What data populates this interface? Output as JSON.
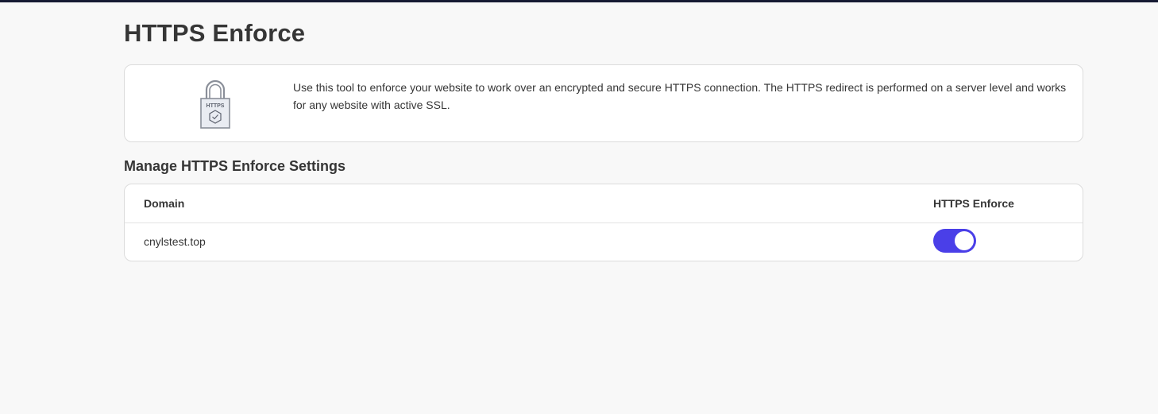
{
  "page": {
    "title": "HTTPS Enforce"
  },
  "info": {
    "icon": "https-lock-icon",
    "icon_label": "HTTPS",
    "description": "Use this tool to enforce your website to work over an encrypted and secure HTTPS connection. The HTTPS redirect is performed on a server level and works for any website with active SSL."
  },
  "settings": {
    "title": "Manage HTTPS Enforce Settings",
    "columns": {
      "domain": "Domain",
      "https_enforce": "HTTPS Enforce"
    },
    "rows": [
      {
        "domain": "cnylstest.top",
        "https_enforce": true
      }
    ]
  },
  "colors": {
    "top_bar": "#161a33",
    "toggle_on": "#4a3fe8",
    "background": "#f8f8f8"
  }
}
